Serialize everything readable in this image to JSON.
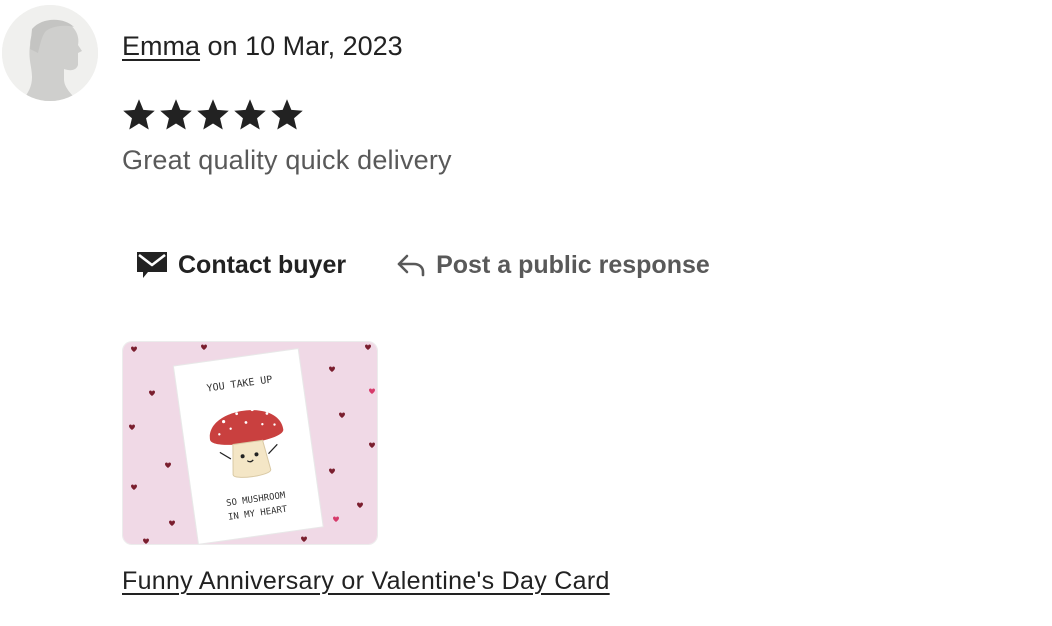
{
  "review": {
    "reviewer_name": "Emma",
    "date_text": "on 10 Mar, 2023",
    "rating": 5,
    "rating_max": 5,
    "text": "Great quality quick delivery"
  },
  "actions": {
    "contact_label": "Contact buyer",
    "contact_icon": "envelope-icon",
    "response_label": "Post a public response",
    "response_icon": "reply-arrow-icon"
  },
  "product": {
    "title": "Funny Anniversary or Valentine's Day Card",
    "card_text_top": "YOU TAKE UP",
    "card_text_mid": "SO MUSHROOM",
    "card_text_bottom": "IN MY HEART"
  },
  "colors": {
    "text": "#222222",
    "muted": "#595959",
    "avatar_bg": "#f0f0ee",
    "card_bg": "#f0d9e6",
    "mushroom": "#c9403f"
  }
}
